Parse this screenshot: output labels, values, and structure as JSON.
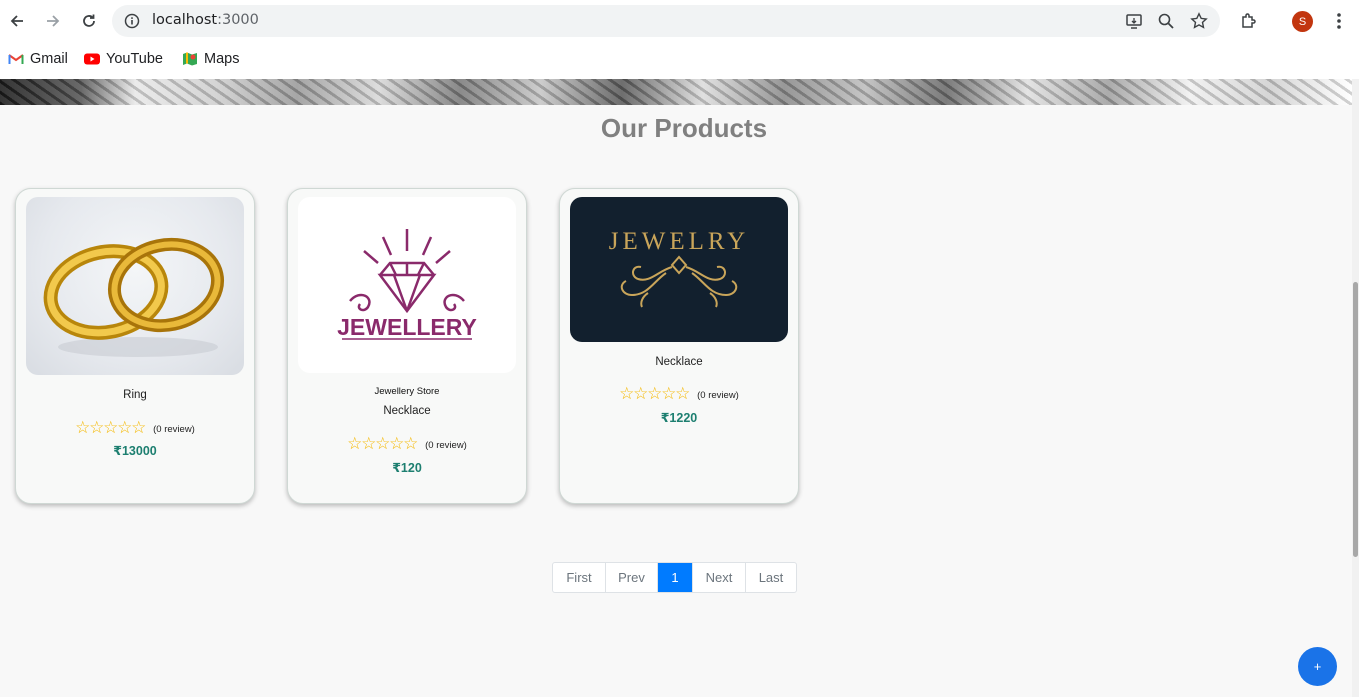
{
  "browser": {
    "url_host": "localhost",
    "url_port": ":3000",
    "avatar_initial": "S",
    "bookmarks": [
      {
        "label": "Gmail",
        "icon": "gmail-icon"
      },
      {
        "label": "YouTube",
        "icon": "youtube-icon"
      },
      {
        "label": "Maps",
        "icon": "maps-icon"
      }
    ]
  },
  "page": {
    "section_title": "Our Products",
    "products": [
      {
        "name": "Ring",
        "store": "",
        "review": "(0 review)",
        "price": "₹13000",
        "rating": 0,
        "image": "gold-rings-photo"
      },
      {
        "name": "Necklace",
        "store": "Jewellery Store",
        "review": "(0 review)",
        "price": "₹120",
        "rating": 0,
        "image": "jewellery-logo",
        "logo_text": "JEWELLERY"
      },
      {
        "name": "Necklace",
        "store": "",
        "review": "(0 review)",
        "price": "₹1220",
        "rating": 0,
        "image": "jewelry-logo-dark",
        "logo_text": "JEWELRY"
      }
    ],
    "pagination": {
      "first": "First",
      "prev": "Prev",
      "current": "1",
      "next": "Next",
      "last": "Last"
    },
    "fab_label": "+"
  },
  "colors": {
    "accent": "#007bff",
    "price": "#1d7f70",
    "star": "#f5b800",
    "logo_purple": "#8a2a6b",
    "logo_gold": "#c9a55a",
    "logo_dark_bg": "#12202e"
  }
}
